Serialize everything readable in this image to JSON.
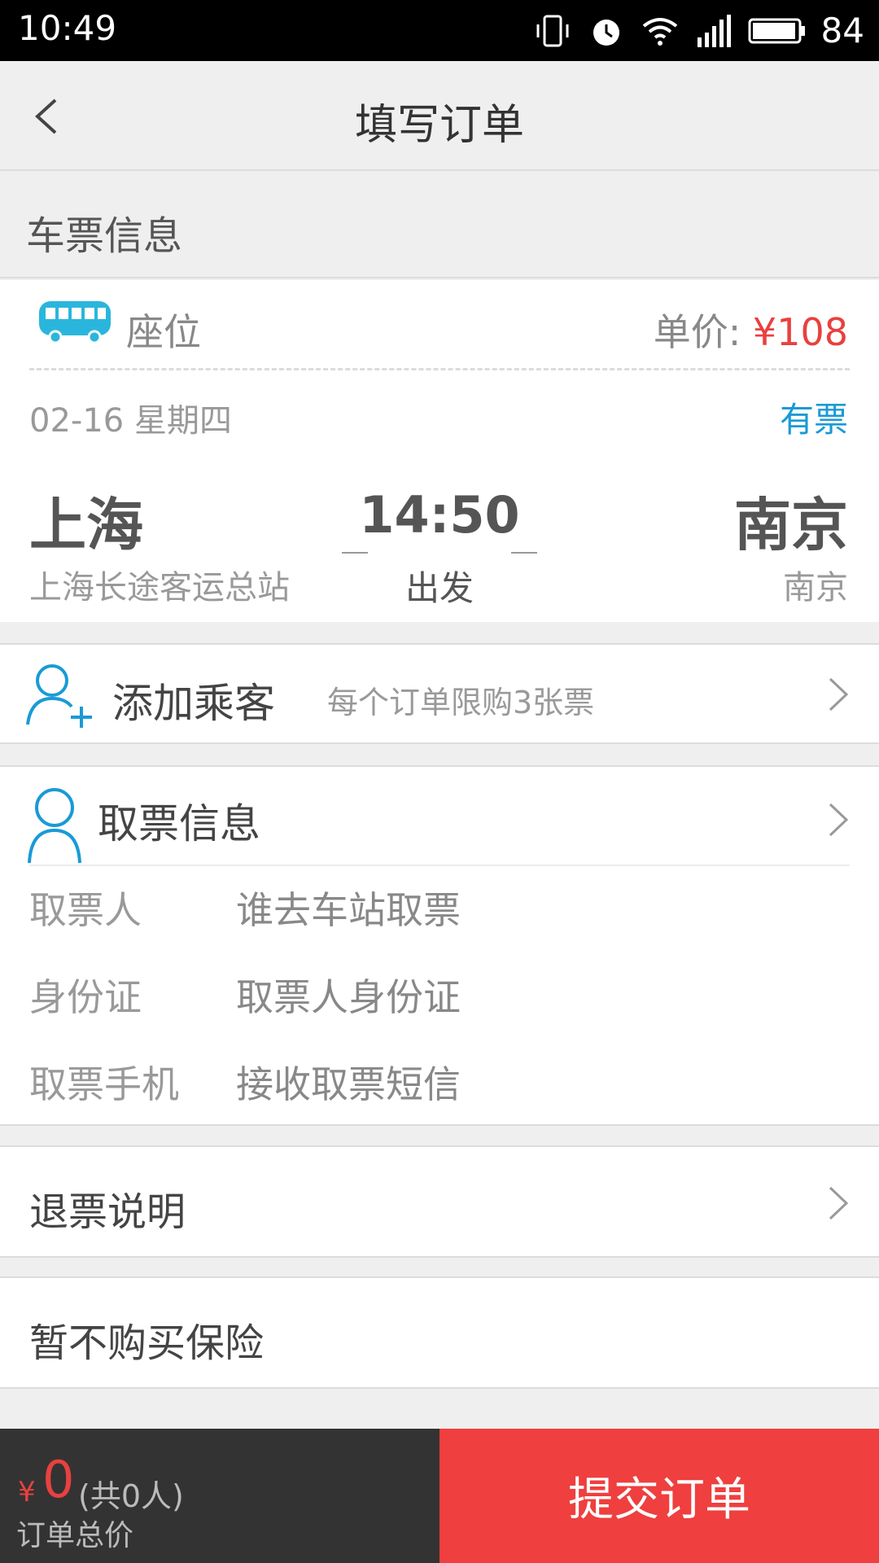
{
  "status_bar": {
    "time": "10:49",
    "battery": "84"
  },
  "nav": {
    "title": "填写订单"
  },
  "section": {
    "ticket_info": "车票信息"
  },
  "ticket": {
    "seat_label": "座位",
    "price_label": "单价: ",
    "price": "¥108",
    "date": "02-16 星期四",
    "availability": "有票",
    "from_city": "上海",
    "from_station": "上海长途客运总站",
    "time": "14:50",
    "depart_label": "出发",
    "to_city": "南京",
    "to_station": "南京"
  },
  "passenger": {
    "label": "添加乘客",
    "hint": "每个订单限购3张票"
  },
  "pickup": {
    "title": "取票信息",
    "rows": [
      {
        "label": "取票人",
        "value": "谁去车站取票"
      },
      {
        "label": "身份证",
        "value": "取票人身份证"
      },
      {
        "label": "取票手机",
        "value": "接收取票短信"
      }
    ]
  },
  "refund": {
    "label": "退票说明"
  },
  "insurance": {
    "label": "暂不购买保险"
  },
  "footer": {
    "yen": "¥",
    "amount": "0",
    "count": "(共0人)",
    "total_label": "订单总价",
    "submit": "提交订单"
  },
  "colors": {
    "accent_red": "#ef3f3f",
    "accent_blue": "#1a9ad6",
    "price_red": "#e8413f"
  },
  "icons": [
    "back-icon",
    "bus-icon",
    "add-passenger-icon",
    "person-icon",
    "chevron-right-icon"
  ]
}
